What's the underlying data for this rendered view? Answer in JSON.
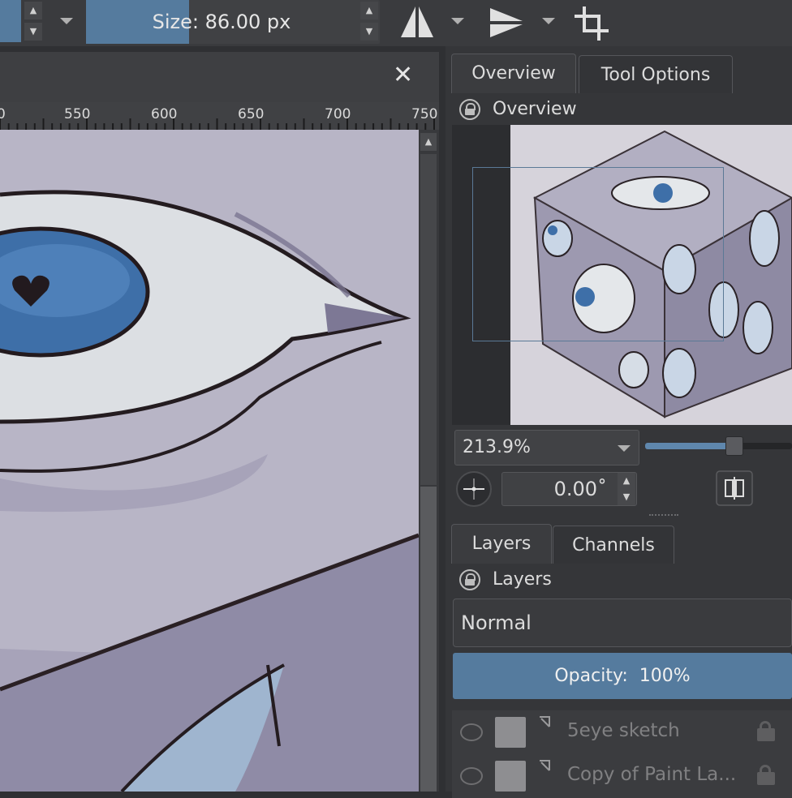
{
  "toolbar": {
    "brush_size_label": "Size: 86.00 px",
    "brush_size_fill_percent": 38,
    "icons": [
      "horizontal-mirror-icon",
      "vertical-mirror-icon",
      "wrap-around-icon"
    ]
  },
  "canvas": {
    "ruler_ticks": [
      "0",
      "550",
      "600",
      "650",
      "700",
      "750"
    ],
    "close_glyph": "✕"
  },
  "docker": {
    "tabs_top": [
      "Overview",
      "Tool Options"
    ],
    "overview_title": "Overview",
    "zoom_value": "213.9%",
    "zoom_slider_percent": 60,
    "rotation_value": "0.00˚",
    "tabs_bottom": [
      "Layers",
      "Channels"
    ],
    "layers_title": "Layers",
    "blend_mode": "Normal",
    "opacity_label": "Opacity:  100%",
    "layers": [
      {
        "name": "5eye sketch"
      },
      {
        "name": "Copy of Paint La..."
      }
    ]
  },
  "colors": {
    "accent": "#557b9e",
    "canvas_bg": "#b7b4c5",
    "iris": "#3e6fa8"
  }
}
